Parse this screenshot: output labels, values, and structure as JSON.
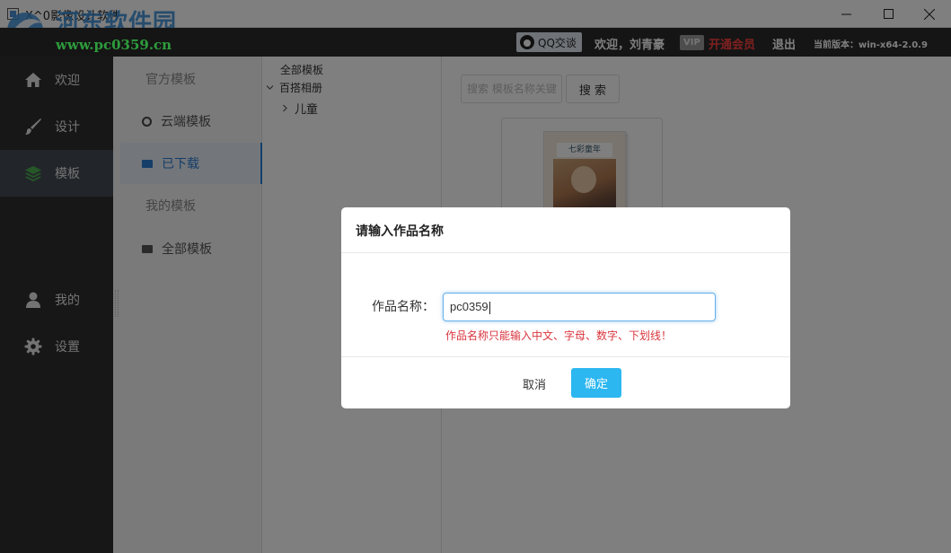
{
  "window": {
    "title": "X^0影像设计软件",
    "watermark_title": "河东软件园",
    "watermark_url": "www.pc0359.cn"
  },
  "topbar": {
    "qq_label": "QQ交谈",
    "welcome": "欢迎，刘青豪",
    "vip_badge": "VIP",
    "vip_link": "开通会员",
    "logout": "退出",
    "version": "当前版本：win-x64-2.0.9"
  },
  "sidebar": {
    "items": [
      {
        "label": "欢迎",
        "icon": "home-icon"
      },
      {
        "label": "设计",
        "icon": "brush-icon"
      },
      {
        "label": "模板",
        "icon": "layers-icon",
        "active": true
      },
      {
        "label": "我的",
        "icon": "user-icon"
      },
      {
        "label": "设置",
        "icon": "gear-icon"
      }
    ]
  },
  "template_nav": {
    "official_heading": "官方模板",
    "cloud": "云端模板",
    "downloaded": "已下载",
    "mine_heading": "我的模板",
    "all": "全部模板"
  },
  "tree": {
    "root": "全部模板",
    "group": "百搭相册",
    "child": "儿童"
  },
  "content": {
    "search_placeholder": "搜索 模板名称关键",
    "search_button": "搜 索",
    "card_title_text": "七彩童年"
  },
  "modal": {
    "title": "请输入作品名称",
    "field_label": "作品名称：",
    "field_value": "pc0359",
    "error": "作品名称只能输入中文、字母、数字、下划线！",
    "cancel": "取消",
    "ok": "确定"
  },
  "colors": {
    "accent": "#2cb7f0",
    "error": "#d9363e",
    "sidebar_bg": "#2f2f2f",
    "vip_link": "#ff4040"
  }
}
